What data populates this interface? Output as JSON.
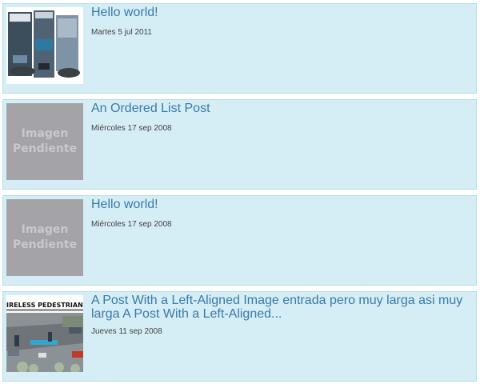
{
  "colors": {
    "card_background": "#d5edf5",
    "card_border": "#b9dbe8",
    "title": "#3a7aa8",
    "date": "#444444",
    "placeholder_background": "#a3a3a8"
  },
  "posts": [
    {
      "title": "Hello world!",
      "date": "Martes 5 jul 2011",
      "thumbnail": "xbox-console-photo"
    },
    {
      "title": "An Ordered List Post",
      "date": "Miércoles 17 sep 2008",
      "thumbnail": "placeholder",
      "placeholder_line1": "Imagen",
      "placeholder_line2": "Pendiente"
    },
    {
      "title": "Hello world!",
      "date": "Miércoles 17 sep 2008",
      "thumbnail": "placeholder",
      "placeholder_line1": "Imagen",
      "placeholder_line2": "Pendiente"
    },
    {
      "title": "A Post With a Left-Aligned Image entrada pero muy larga asi muy larga A Post With a Left-Aligned...",
      "date": "Jueves 11 sep 2008",
      "thumbnail": "pedestrian-detection-street-image",
      "thumbnail_caption": "IRELESS PEDESTRIAN DET"
    }
  ]
}
